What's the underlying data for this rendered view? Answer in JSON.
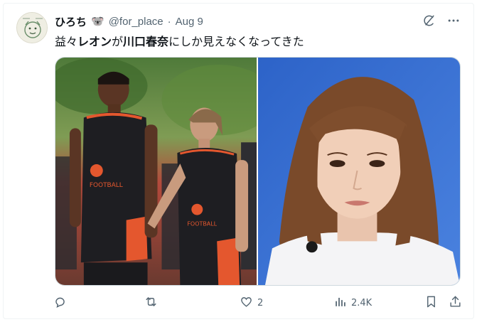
{
  "tweet": {
    "author_name": "ひろち",
    "author_emoji": "🐨",
    "handle": "@for_place",
    "separator": "·",
    "date": "Aug 9",
    "text_parts": [
      "益々",
      "レオン",
      "が",
      "川口春奈",
      "にしか見えなくなってきた"
    ]
  },
  "actions": {
    "reply_count": "",
    "retweet_count": "",
    "like_count": "2",
    "views_count": "2.4K"
  },
  "icons": {
    "grok": "grok-icon",
    "more": "more-icon",
    "reply": "reply-icon",
    "retweet": "retweet-icon",
    "like": "heart-icon",
    "views": "views-chart-icon",
    "bookmark": "bookmark-icon",
    "share": "share-icon"
  },
  "colors": {
    "text": "#0f1419",
    "secondary": "#536471",
    "border": "#cfd9de",
    "jersey_orange": "#e4572e",
    "backdrop_blue": "#3b6fd0"
  }
}
